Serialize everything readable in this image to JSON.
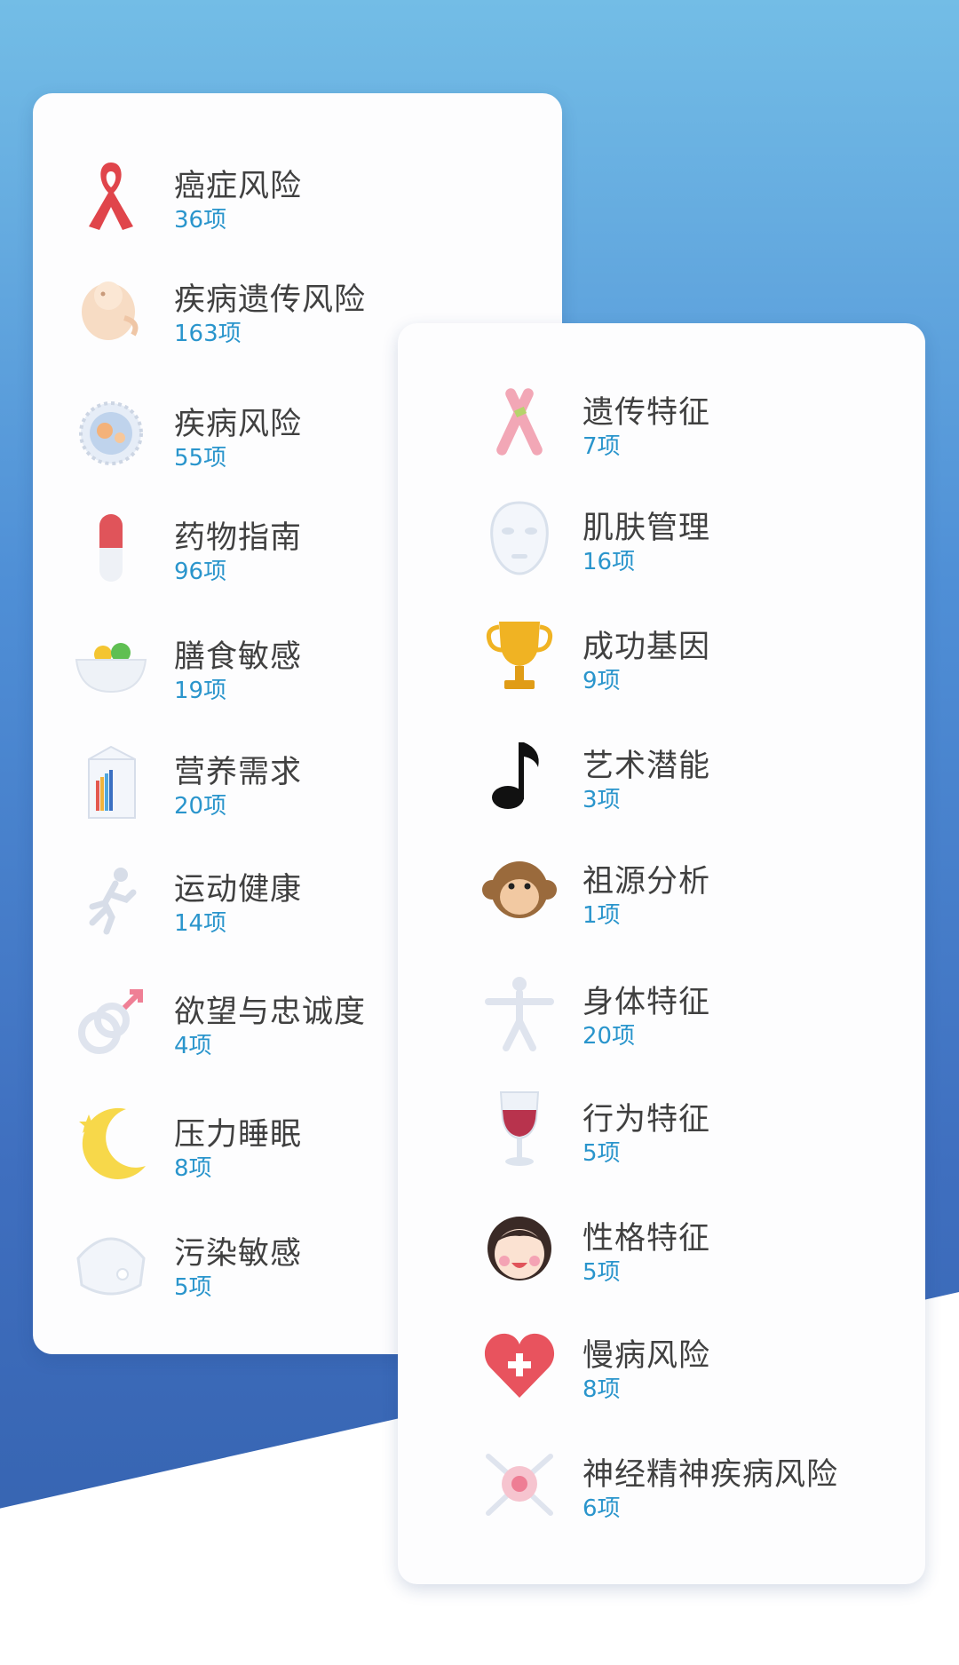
{
  "left_panel": {
    "items": [
      {
        "title": "癌症风险",
        "count": "36项",
        "icon": "ribbon-icon"
      },
      {
        "title": "疾病遗传风险",
        "count": "163项",
        "icon": "fetus-icon"
      },
      {
        "title": "疾病风险",
        "count": "55项",
        "icon": "cell-icon"
      },
      {
        "title": "药物指南",
        "count": "96项",
        "icon": "capsule-icon"
      },
      {
        "title": "膳食敏感",
        "count": "19项",
        "icon": "bowl-icon"
      },
      {
        "title": "营养需求",
        "count": "20项",
        "icon": "milk-carton-icon"
      },
      {
        "title": "运动健康",
        "count": "14项",
        "icon": "runner-icon"
      },
      {
        "title": "欲望与忠诚度",
        "count": "4项",
        "icon": "ring-arrow-icon"
      },
      {
        "title": "压力睡眠",
        "count": "8项",
        "icon": "moon-icon"
      },
      {
        "title": "污染敏感",
        "count": "5项",
        "icon": "mask-icon"
      }
    ]
  },
  "right_panel": {
    "items": [
      {
        "title": "遗传特征",
        "count": "7项",
        "icon": "chromosome-icon"
      },
      {
        "title": "肌肤管理",
        "count": "16项",
        "icon": "face-mask-icon"
      },
      {
        "title": "成功基因",
        "count": "9项",
        "icon": "trophy-icon"
      },
      {
        "title": "艺术潜能",
        "count": "3项",
        "icon": "music-note-icon"
      },
      {
        "title": "祖源分析",
        "count": "1项",
        "icon": "monkey-icon"
      },
      {
        "title": "身体特征",
        "count": "20项",
        "icon": "body-figure-icon"
      },
      {
        "title": "行为特征",
        "count": "5项",
        "icon": "wine-glass-icon"
      },
      {
        "title": "性格特征",
        "count": "5项",
        "icon": "girl-face-icon"
      },
      {
        "title": "慢病风险",
        "count": "8项",
        "icon": "heart-plus-icon"
      },
      {
        "title": "神经精神疾病风险",
        "count": "6项",
        "icon": "neuron-icon"
      }
    ]
  },
  "colors": {
    "background_top": "#73bde6",
    "background_bottom": "#3461ad",
    "count_text": "#2a95cc",
    "title_text": "#404040"
  }
}
